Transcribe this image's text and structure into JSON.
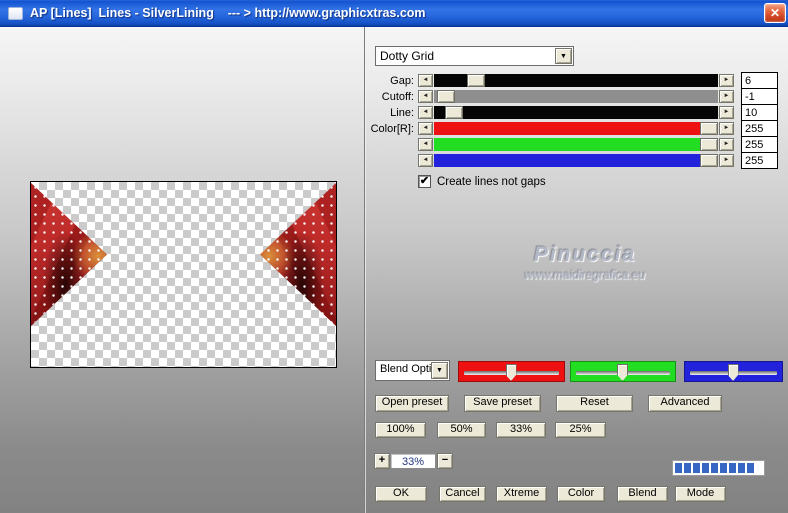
{
  "window": {
    "title": "AP [Lines]  Lines - SilverLining    --- > http://www.graphicxtras.com",
    "close_glyph": "✕"
  },
  "filter_dropdown": {
    "value": "Dotty Grid",
    "arrow_glyph": "▼"
  },
  "params": {
    "left_arrow_glyph": "◄",
    "right_arrow_glyph": "►",
    "track_colors": [
      "#050505",
      "#8e8e8e",
      "#050505",
      "#ee1111",
      "#22dd22",
      "#2222dd"
    ],
    "rows": [
      {
        "label": "Gap:",
        "value": "6"
      },
      {
        "label": "Cutoff:",
        "value": "-1"
      },
      {
        "label": "Line:",
        "value": "10"
      },
      {
        "label": "Color[R]:",
        "value": "255"
      },
      {
        "label": "",
        "value": "255"
      },
      {
        "label": "",
        "value": "255"
      }
    ]
  },
  "checkbox": {
    "label": "Create lines not gaps",
    "checked": true,
    "glyph": "✔"
  },
  "watermark": {
    "line1": "Pinuccia",
    "line2": "www.maidiregrafica.eu"
  },
  "blend": {
    "dropdown_value": "Blend Opti",
    "arrow_glyph": "▼",
    "channel_colors": [
      "#ee1111",
      "#22dd22",
      "#2222dd"
    ]
  },
  "preset_buttons": {
    "open": "Open preset",
    "save": "Save preset",
    "reset": "Reset",
    "advanced": "Advanced"
  },
  "zoom_buttons": {
    "b100": "100%",
    "b50": "50%",
    "b33": "33%",
    "b25": "25%"
  },
  "zoom_stepper": {
    "plus": "+",
    "value": "33%",
    "minus": "−"
  },
  "progress": {
    "segments": 9,
    "color": "#3767c5"
  },
  "action_buttons": {
    "ok": "OK",
    "cancel": "Cancel",
    "xtreme": "Xtreme",
    "color": "Color",
    "blend": "Blend",
    "mode": "Mode"
  }
}
